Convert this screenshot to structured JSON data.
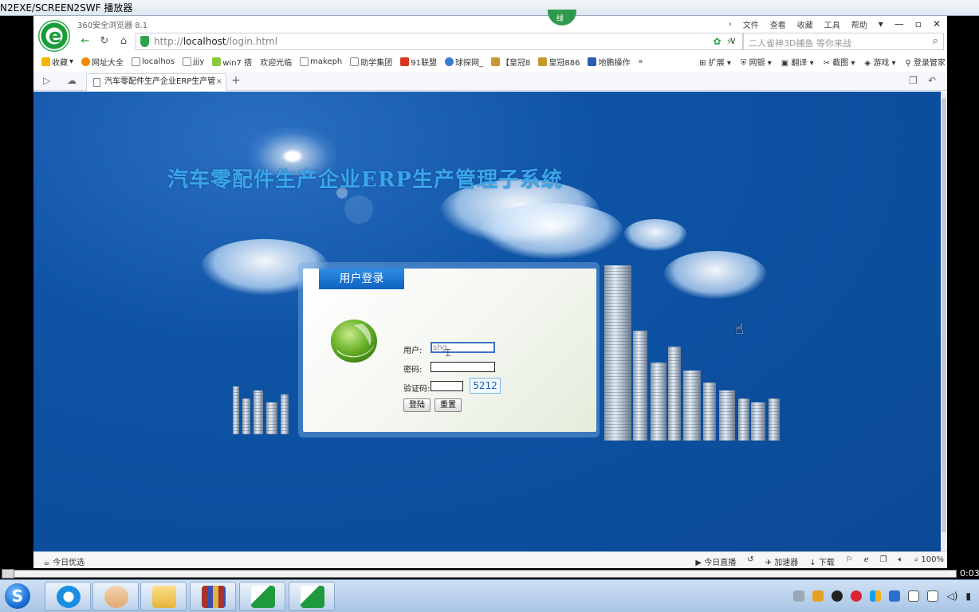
{
  "player": {
    "title": "N2EXE/SCREEN2SWF 播放器",
    "time": "0:03"
  },
  "browser": {
    "name": "360安全浏览器 8.1",
    "badge": "绿",
    "menu": [
      "文件",
      "查看",
      "收藏",
      "工具",
      "帮助"
    ],
    "url_prefix": "http://",
    "url_host": "localhost",
    "url_path": "/login.html",
    "search_placeholder": "二人雀神3D捕鱼 等你来战"
  },
  "bookmarks": {
    "items": [
      {
        "label": "收藏",
        "color": "#f5b400"
      },
      {
        "label": "网址大全",
        "color": "#f08a00"
      },
      {
        "label": "localhos",
        "color": "#ffffff"
      },
      {
        "label": "jjjy",
        "color": "#ffffff"
      },
      {
        "label": "win7 搭",
        "color": "#8cc63f"
      },
      {
        "label": "欢迎光临",
        "color": "#ffffff"
      },
      {
        "label": "makeph",
        "color": "#ffffff"
      },
      {
        "label": "助学集团",
        "color": "#ffffff"
      },
      {
        "label": "91联盟",
        "color": "#d9381e"
      },
      {
        "label": "球探网_",
        "color": "#3a7bd5"
      },
      {
        "label": "【皇冠8",
        "color": "#c49a2c"
      },
      {
        "label": "皇冠886",
        "color": "#c49a2c"
      },
      {
        "label": "地鹏操作",
        "color": "#2a5db0"
      }
    ],
    "more": "»",
    "right": [
      "扩展",
      "网银",
      "翻译",
      "截图",
      "游戏",
      "登录管家"
    ]
  },
  "tab": {
    "title": "汽车零配件生产企业ERP生产管",
    "close": "×",
    "add": "+"
  },
  "page": {
    "title": "汽车零配件生产企业ERP生产管理子系统",
    "login": {
      "tab_label": "用户登录",
      "user_label": "用户:",
      "user_value": "shg",
      "password_label": "密码:",
      "captcha_label": "验证码:",
      "captcha_value": "5212",
      "login_button": "登陆",
      "reset_button": "重置"
    }
  },
  "statusbar": {
    "left": "今日优选",
    "right": [
      "今日直播",
      "",
      "加速器",
      "下载",
      "",
      "",
      "",
      "",
      "100%"
    ]
  }
}
